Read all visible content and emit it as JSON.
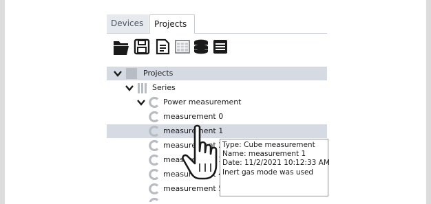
{
  "tabs": [
    {
      "label": "Devices",
      "active": false
    },
    {
      "label": "Projects",
      "active": true
    }
  ],
  "toolbar": {
    "icons": [
      "open-folder-icon",
      "save-icon",
      "document-icon",
      "table-icon",
      "database-icon",
      "list-icon"
    ]
  },
  "tree": {
    "root": "Projects",
    "series": "Series",
    "group": "Power measurement",
    "items": [
      "measurement 0",
      "measurement 1",
      "measurement 2",
      "measurement 3",
      "measurement 4",
      "measurement 5"
    ],
    "selected_item": "measurement 1"
  },
  "tooltip": {
    "line1": "Type: Cube measurement",
    "line2": "Name: measurement 1",
    "line3": "Date: 11/2/2021 10:12:33 AM",
    "line4": "Inert gas mode was used"
  },
  "colors": {
    "selection": "#d5dae3",
    "icon_grey": "#b8bcc4",
    "toolbar_icon": "#1a1a1a"
  }
}
